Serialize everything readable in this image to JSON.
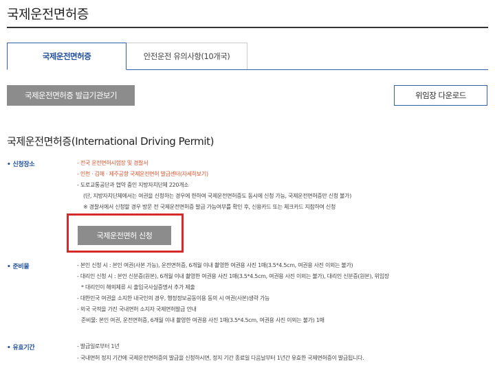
{
  "page_title": "국제운전면허증",
  "tabs": [
    {
      "label": "국제운전면허증",
      "active": true
    },
    {
      "label": "안전운전 유의사항(10개국)",
      "active": false
    }
  ],
  "buttons": {
    "issuer_view": "국제운전면허증 발급기관보기",
    "proxy_download": "위임장 다운로드",
    "apply": "국제운전면허 신청"
  },
  "section_title": "국제운전면허증(International Driving Permit)",
  "place": {
    "label": "신청장소",
    "lines": [
      "- 전국 운전면허시험장 및 경찰서",
      "- 인천 · 김해 · 제주공항 국제운전면허 발급센터(자세히보기)",
      "- 도로교통공단과 협약 중인 지방자치단체 220개소",
      "(단, 지방자치단체에서는 여권을 신청하는 경우에 한하여 국제운전면허증도 동시에 신청 가능, 국제운전면허증만 신청 불가)",
      "※ 경찰서에서 신청할 경우 방문 전 국제운전면허증 발급 가능여부를 확인 후, 신용카드 또는 체크카드 지참하여 신청"
    ]
  },
  "documents": {
    "label": "준비물",
    "lines": [
      "- 본인 신청 시 : 본인 여권(사본 가능), 운전면허증, 6개월 이내 촬영한 여권용 사진 1매(3.5*4.5cm, 여권용 사진 이외는 불가)",
      "- 대리인 신청 시 : 본인 신분증(원본), 6개월 이내 촬영한 여권용 사진 1매(3.5*4.5cm, 여권용 사진 이외는 불가), 대리인 신분증(원본), 위임장",
      "* 대리인이 해외체류 시 출입국사실증명서 추가 제출",
      "- 대한민국 여권을 소지한 내국인의 경우, 행정정보공동이용 동의 시 여권(사본)생략 가능",
      "- 외국 국적을 가진 국내면허 소지자 국제면허발급 안내",
      "준비물: 본인 여권, 운전면허증, 6개월 이내 촬영한 여권용 사진 1매(3.5*4.5cm, 여권용 사진 이외는 불가) 1매"
    ]
  },
  "validity": {
    "label": "유효기간",
    "lines": [
      "- 발급일로부터 1년",
      "- 국내면허 정지 기간에 국제운전면허증의 발급을 신청하시면, 정지 기간 종료일 다음날부터 1년간 유효한 국제면허증이 발급됩니다."
    ]
  },
  "colors": {
    "accent_blue": "#2f5fa6",
    "highlight_red": "#d62a2a",
    "note_orange": "#d9532c",
    "button_gray": "#8c8c8c"
  }
}
